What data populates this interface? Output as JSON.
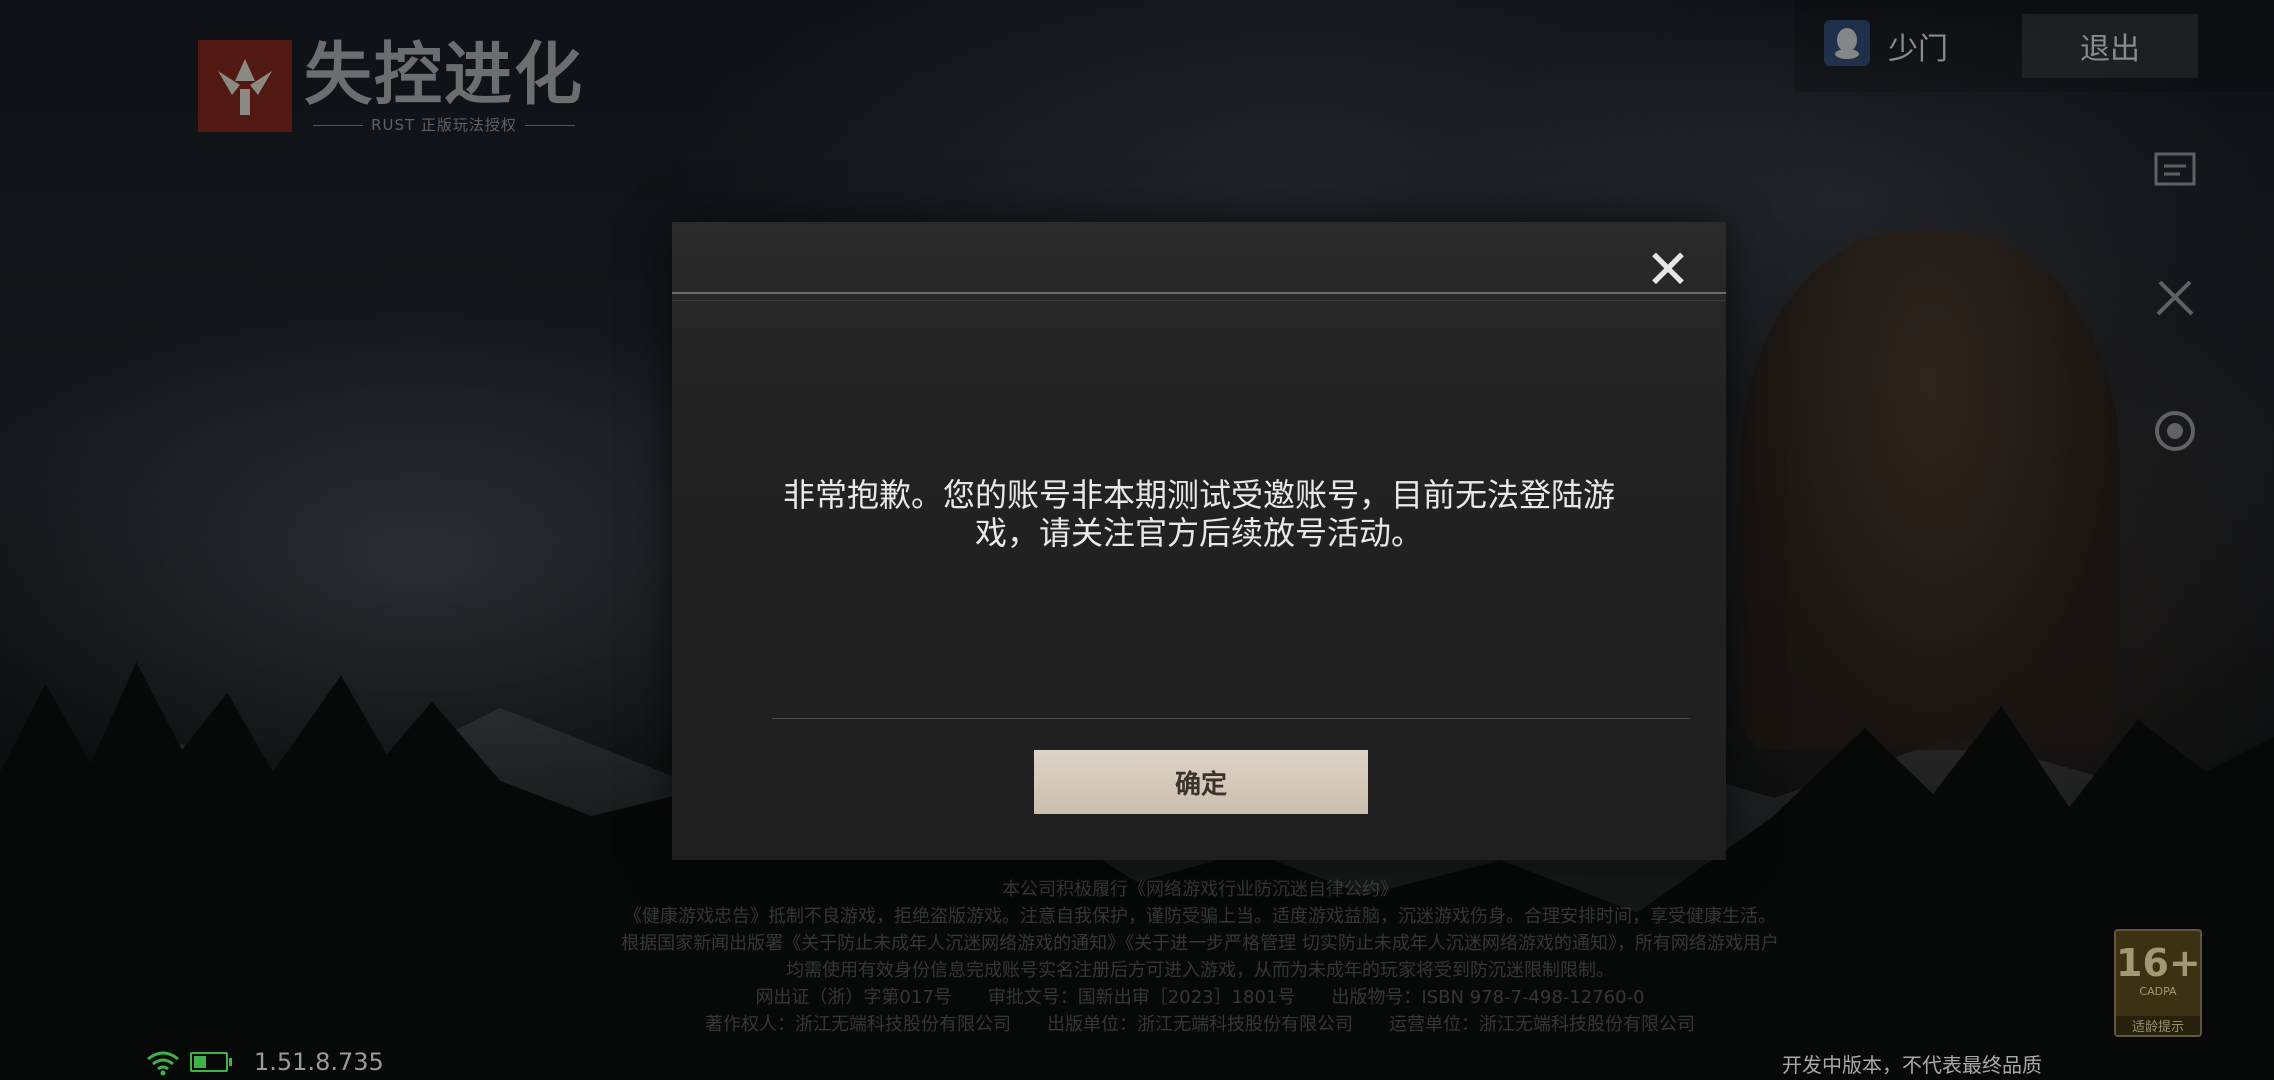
{
  "logo": {
    "title": "失控进化",
    "subtitle": "RUST 正版玩法授权"
  },
  "topbar": {
    "username": "少门",
    "logout_label": "退出",
    "login_icon": "qq-icon"
  },
  "side_icons": [
    "notice-icon",
    "tools-icon",
    "customer-service-icon"
  ],
  "dialog": {
    "close_icon": "close-icon",
    "message_line1": "非常抱歉。您的账号非本期测试受邀账号，目前无法登陆游",
    "message_line2": "戏，请关注官方后续放号活动。",
    "ok_label": "确定"
  },
  "legal": {
    "lines": [
      "本公司积极履行《网络游戏行业防沉迷自律公约》",
      "《健康游戏忠告》抵制不良游戏，拒绝盗版游戏。注意自我保护，谨防受骗上当。适度游戏益脑，沉迷游戏伤身。合理安排时间，享受健康生活。",
      "根据国家新闻出版署《关于防止未成年人沉迷网络游戏的通知》《关于进一步严格管理 切实防止未成年人沉迷网络游戏的通知》，所有网络游戏用户",
      "均需使用有效身份信息完成账号实名注册后方可进入游戏，从而为未成年的玩家将受到防沉迷限制限制。",
      "网出证（浙）字第017号　　审批文号：国新出审［2023］1801号　　出版物号：ISBN 978-7-498-12760-0",
      "著作权人：浙江无端科技股份有限公司　　出版单位：浙江无端科技股份有限公司　　运营单位：浙江无端科技股份有限公司"
    ]
  },
  "status": {
    "version": "1.51.8.735",
    "dev_note": "开发中版本，不代表最终品质"
  },
  "rating": {
    "age": "16+",
    "code": "CADPA",
    "label": "适龄提示"
  }
}
